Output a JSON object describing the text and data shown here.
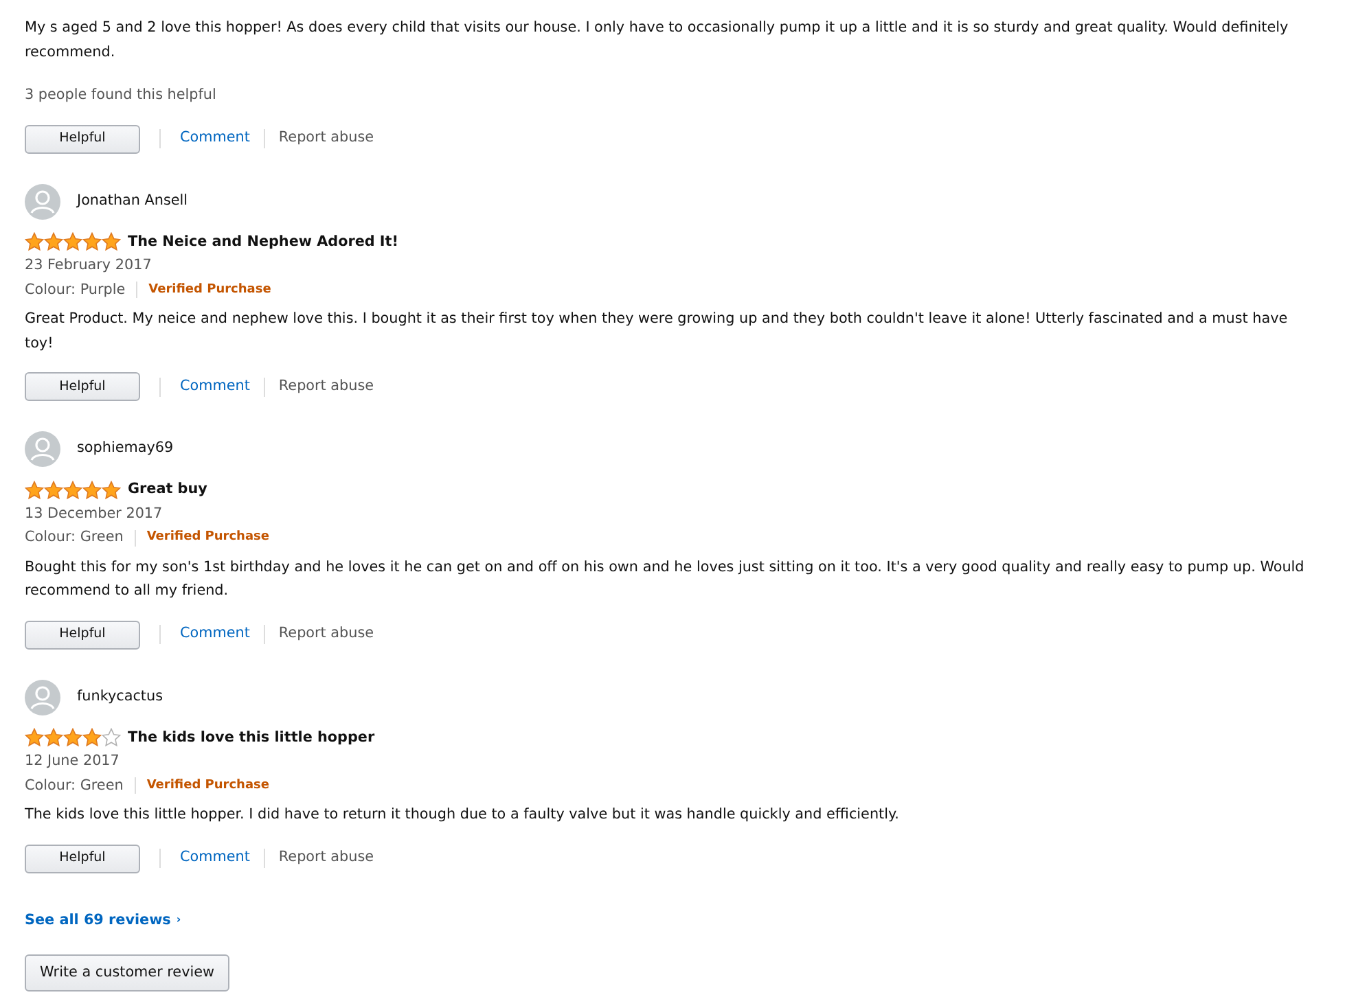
{
  "reviews": [
    {
      "body": "My s aged 5 and 2 love this hopper! As does every child that visits our house. I only have to occasionally pump it up a little and it is so sturdy and great quality. Would definitely recommend.",
      "helpful_count": "3 people found this helpful",
      "actions": {
        "helpful": "Helpful",
        "comment": "Comment",
        "report": "Report abuse"
      }
    },
    {
      "author": "Jonathan Ansell",
      "stars": 5,
      "title": "The Neice and Nephew Adored It!",
      "date": "23 February 2017",
      "colour": "Colour: Purple",
      "verified": "Verified Purchase",
      "body": "Great Product. My neice and nephew love this. I bought it as their first toy when they were growing up and they both couldn't leave it alone! Utterly fascinated and a must have toy!",
      "actions": {
        "helpful": "Helpful",
        "comment": "Comment",
        "report": "Report abuse"
      }
    },
    {
      "author": "sophiemay69",
      "stars": 5,
      "title": "Great buy",
      "date": "13 December 2017",
      "colour": "Colour: Green",
      "verified": "Verified Purchase",
      "body": "Bought this for my son's 1st birthday and he loves it he can get on and off on his own and he loves just sitting on it too. It's a very good quality and really easy to pump up. Would recommend to all my friend.",
      "actions": {
        "helpful": "Helpful",
        "comment": "Comment",
        "report": "Report abuse"
      }
    },
    {
      "author": "funkycactus",
      "stars": 4,
      "title": "The kids love this little hopper",
      "date": "12 June 2017",
      "colour": "Colour: Green",
      "verified": "Verified Purchase",
      "body": "The kids love this little hopper. I did have to return it though due to a faulty valve but it was handle quickly and efficiently.",
      "actions": {
        "helpful": "Helpful",
        "comment": "Comment",
        "report": "Report abuse"
      }
    }
  ],
  "see_all": {
    "label": "See all 69 reviews",
    "arrow": "›"
  },
  "write_review": "Write a customer review"
}
